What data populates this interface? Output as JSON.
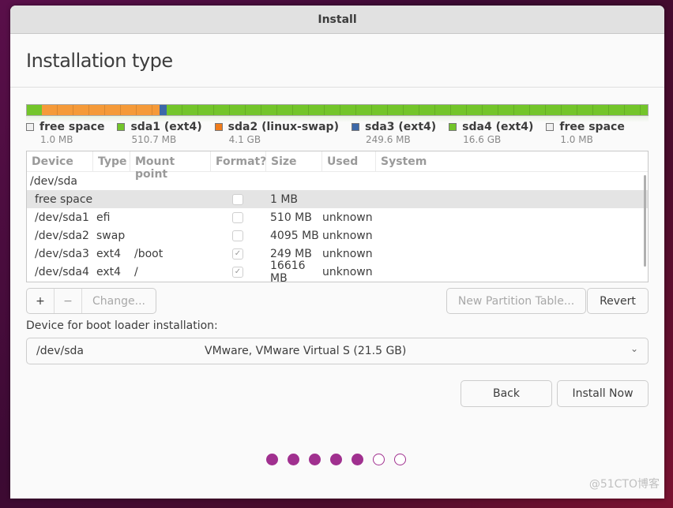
{
  "window": {
    "title": "Install"
  },
  "page": {
    "title": "Installation type"
  },
  "partition_bar": {
    "segments": [
      {
        "name": "sda1",
        "fraction": 0.024,
        "color": "#73c52a"
      },
      {
        "name": "sda2",
        "fraction": 0.19,
        "color": "#f59a39"
      },
      {
        "name": "sda3",
        "fraction": 0.011,
        "color": "#3c68a8"
      },
      {
        "name": "sda4",
        "fraction": 0.775,
        "color": "#73c52a"
      }
    ]
  },
  "legend": [
    {
      "label": "free space",
      "size": "1.0 MB",
      "color": "#f0f0f0"
    },
    {
      "label": "sda1 (ext4)",
      "size": "510.7 MB",
      "color": "#73c52a"
    },
    {
      "label": "sda2 (linux-swap)",
      "size": "4.1 GB",
      "color": "#f07c1c"
    },
    {
      "label": "sda3 (ext4)",
      "size": "249.6 MB",
      "color": "#3c68a8"
    },
    {
      "label": "sda4 (ext4)",
      "size": "16.6 GB",
      "color": "#73c52a"
    },
    {
      "label": "free space",
      "size": "1.0 MB",
      "color": "#f0f0f0"
    }
  ],
  "table": {
    "columns": [
      "Device",
      "Type",
      "Mount point",
      "Format?",
      "Size",
      "Used",
      "System"
    ],
    "group": "/dev/sda",
    "rows": [
      {
        "device": "free space",
        "type": "",
        "mount": "",
        "format": false,
        "size": "1 MB",
        "used": "",
        "system": "",
        "selected": true
      },
      {
        "device": "/dev/sda1",
        "type": "efi",
        "mount": "",
        "format": false,
        "size": "510 MB",
        "used": "unknown",
        "system": ""
      },
      {
        "device": "/dev/sda2",
        "type": "swap",
        "mount": "",
        "format": false,
        "size": "4095 MB",
        "used": "unknown",
        "system": ""
      },
      {
        "device": "/dev/sda3",
        "type": "ext4",
        "mount": "/boot",
        "format": true,
        "size": "249 MB",
        "used": "unknown",
        "system": ""
      },
      {
        "device": "/dev/sda4",
        "type": "ext4",
        "mount": "/",
        "format": true,
        "size": "16616 MB",
        "used": "unknown",
        "system": ""
      }
    ]
  },
  "buttons": {
    "add": "+",
    "remove": "−",
    "change": "Change...",
    "new_table": "New Partition Table...",
    "revert": "Revert",
    "back": "Back",
    "install": "Install Now"
  },
  "bootloader": {
    "label": "Device for boot loader installation:",
    "device": "/dev/sda",
    "description": "VMware, VMware Virtual S (21.5 GB)",
    "chevron": "chevron-down-icon"
  },
  "progress": {
    "total_steps": 7,
    "completed_steps": 5,
    "color": "#a0308f"
  },
  "watermark": "@51CTO博客"
}
